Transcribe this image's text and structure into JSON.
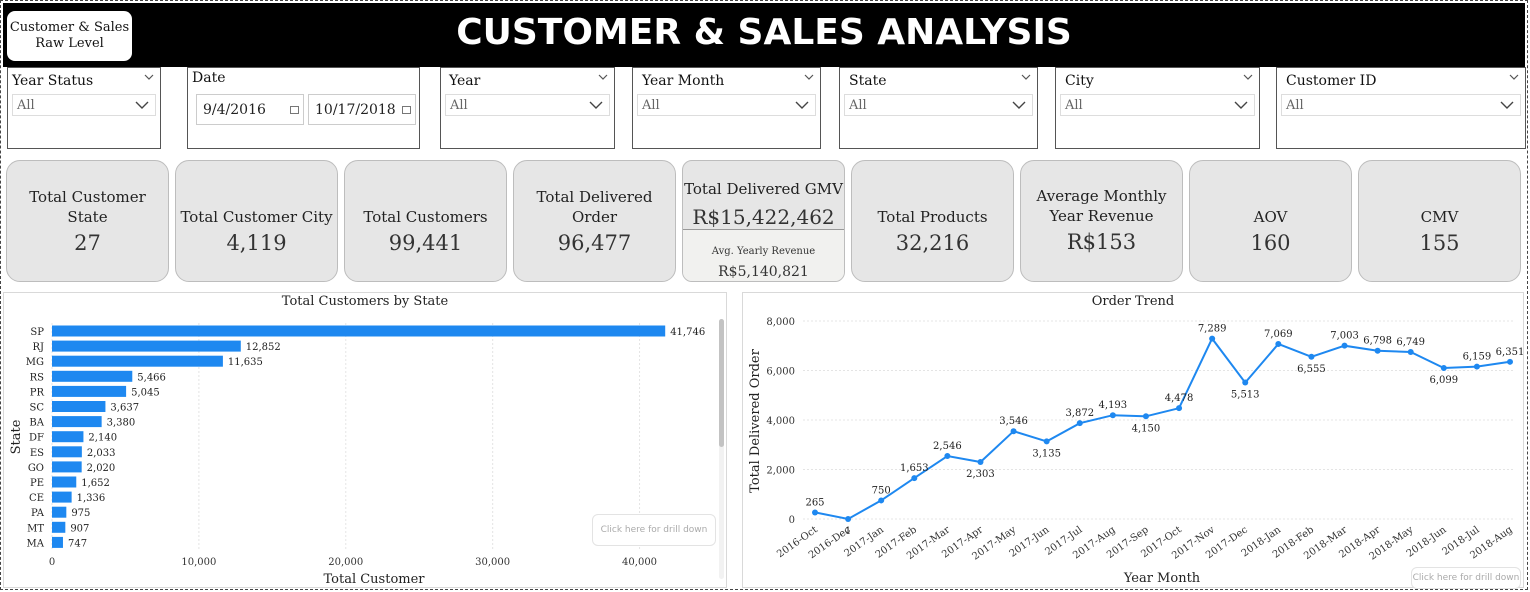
{
  "header": {
    "title": "CUSTOMER & SALES ANALYSIS",
    "nav_line1": "Customer & Sales",
    "nav_line2": "Raw Level"
  },
  "slicers": {
    "year_status": {
      "label": "Year Status",
      "value": "All"
    },
    "date": {
      "label": "Date",
      "start": "9/4/2016",
      "end": "10/17/2018"
    },
    "year": {
      "label": "Year",
      "value": "All"
    },
    "year_month": {
      "label": "Year Month",
      "value": "All"
    },
    "state": {
      "label": "State",
      "value": "All"
    },
    "city": {
      "label": "City",
      "value": "All"
    },
    "customer_id": {
      "label": "Customer ID",
      "value": "All"
    }
  },
  "kpis": {
    "customer_state": {
      "line1": "Total Customer",
      "line2": "State",
      "value": "27"
    },
    "customer_city": {
      "label": "Total Customer City",
      "value": "4,119"
    },
    "customers": {
      "label": "Total Customers",
      "value": "99,441"
    },
    "delivered_order": {
      "line1": "Total Delivered",
      "line2": "Order",
      "value": "96,477"
    },
    "gmv": {
      "label": "Total Delivered GMV",
      "value": "R$15,422,462",
      "sub_label": "Avg. Yearly Revenue",
      "sub_value": "R$5,140,821"
    },
    "products": {
      "label": "Total Products",
      "value": "32,216"
    },
    "avg_monthly": {
      "line1": "Average Monthly",
      "line2": "Year Revenue",
      "value": "R$153"
    },
    "aov": {
      "label": "AOV",
      "value": "160"
    },
    "cmv": {
      "label": "CMV",
      "value": "155"
    }
  },
  "drill_text": "Click here for drill down",
  "colors": {
    "bar": "#1e88f0",
    "line": "#1e88f0",
    "header": "#000000",
    "card": "#e6e6e6"
  },
  "chart_data": [
    {
      "type": "bar",
      "orientation": "horizontal",
      "title": "Total Customers by State",
      "xlabel": "Total Customer",
      "ylabel": "State",
      "categories": [
        "SP",
        "RJ",
        "MG",
        "RS",
        "PR",
        "SC",
        "BA",
        "DF",
        "ES",
        "GO",
        "PE",
        "CE",
        "PA",
        "MT",
        "MA"
      ],
      "values": [
        41746,
        12852,
        11635,
        5466,
        5045,
        3637,
        3380,
        2140,
        2033,
        2020,
        1652,
        1336,
        975,
        907,
        747
      ],
      "value_labels": [
        "41,746",
        "12,852",
        "11,635",
        "5,466",
        "5,045",
        "3,637",
        "3,380",
        "2,140",
        "2,033",
        "2,020",
        "1,652",
        "1,336",
        "975",
        "907",
        "747"
      ],
      "xlim": [
        0,
        45000
      ],
      "xticks": [
        0,
        10000,
        20000,
        30000,
        40000
      ],
      "xtick_labels": [
        "0",
        "10,000",
        "20,000",
        "30,000",
        "40,000"
      ],
      "grid": true
    },
    {
      "type": "line",
      "title": "Order Trend",
      "xlabel": "Year Month",
      "ylabel": "Total Delivered Order",
      "x": [
        "2016-Oct",
        "2016-Dec",
        "2017-Jan",
        "2017-Feb",
        "2017-Mar",
        "2017-Apr",
        "2017-May",
        "2017-Jun",
        "2017-Jul",
        "2017-Aug",
        "2017-Sep",
        "2017-Oct",
        "2017-Nov",
        "2017-Dec",
        "2018-Jan",
        "2018-Feb",
        "2018-Mar",
        "2018-Apr",
        "2018-May",
        "2018-Jun",
        "2018-Jul",
        "2018-Aug"
      ],
      "values": [
        265,
        1,
        750,
        1653,
        2546,
        2303,
        3546,
        3135,
        3872,
        4193,
        4150,
        4478,
        7289,
        5513,
        7069,
        6555,
        7003,
        6798,
        6749,
        6099,
        6159,
        6351
      ],
      "value_labels": [
        "265",
        "1",
        "750",
        "1,653",
        "2,546",
        "2,303",
        "3,546",
        "3,135",
        "3,872",
        "4,193",
        "4,150",
        "4,478",
        "7,289",
        "5,513",
        "7,069",
        "6,555",
        "7,003",
        "6,798",
        "6,749",
        "6,099",
        "6,159",
        "6,351"
      ],
      "ylim": [
        0,
        8000
      ],
      "yticks": [
        0,
        2000,
        4000,
        6000,
        8000
      ],
      "ytick_labels": [
        "0",
        "2,000",
        "4,000",
        "6,000",
        "8,000"
      ],
      "grid": true
    }
  ]
}
